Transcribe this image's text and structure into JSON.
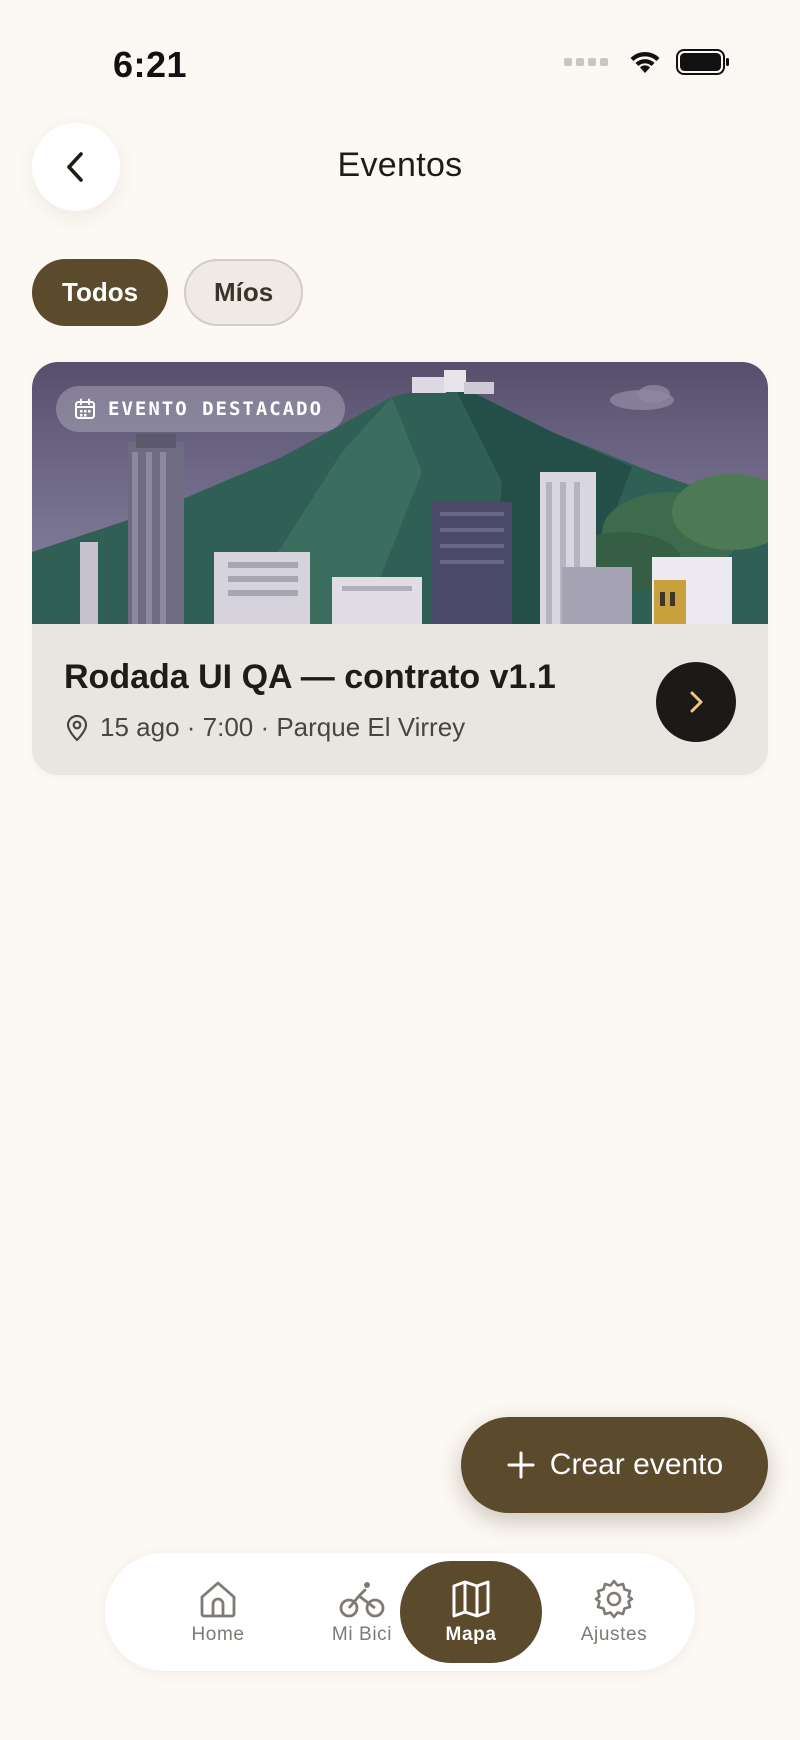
{
  "status_bar": {
    "time": "6:21"
  },
  "header": {
    "title": "Eventos"
  },
  "filters": [
    {
      "label": "Todos",
      "active": true
    },
    {
      "label": "Míos",
      "active": false
    }
  ],
  "event_card": {
    "badge": "EVENTO DESTACADO",
    "title": "Rodada UI QA — contrato v1.1",
    "meta": "15 ago · 7:00 · Parque El Virrey"
  },
  "fab": {
    "label": "Crear evento"
  },
  "bottom_nav": {
    "items": [
      {
        "label": "Home",
        "icon": "home-icon",
        "active": false
      },
      {
        "label": "Mi Bici",
        "icon": "bicycle-icon",
        "active": false
      },
      {
        "label": "Mapa",
        "icon": "map-icon",
        "active": true
      },
      {
        "label": "Ajustes",
        "icon": "gear-icon",
        "active": false
      }
    ]
  },
  "colors": {
    "background": "#FCF8F3",
    "accent": "#5C4A2C",
    "card": "#E9E6E1",
    "dark_button": "#1B1A18"
  }
}
